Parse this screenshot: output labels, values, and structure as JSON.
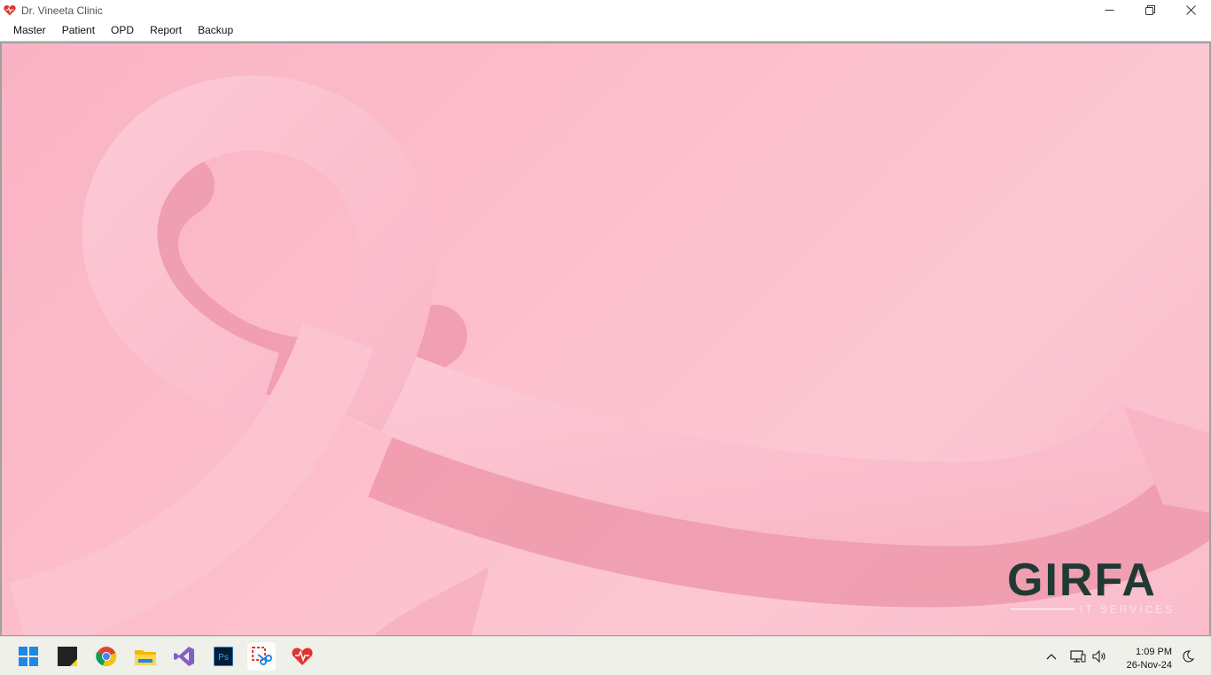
{
  "window": {
    "title": "Dr. Vineeta Clinic",
    "controls": {
      "minimize": "—",
      "restore": "❐",
      "close": "✕"
    }
  },
  "menu": {
    "items": [
      "Master",
      "Patient",
      "OPD",
      "Report",
      "Backup"
    ]
  },
  "background": {
    "logo_text": "GIRFA",
    "logo_sub": "IT SERVICES",
    "colors": {
      "ribbon": "#fcc0cf",
      "ribbon_shadow": "#ee94a8",
      "logo": "#1f3a33"
    }
  },
  "taskbar": {
    "apps": [
      "windows-start-icon",
      "sticky-notes-icon",
      "chrome-icon",
      "file-explorer-icon",
      "visual-studio-icon",
      "photoshop-icon",
      "snipping-tool-icon",
      "clinic-app-icon"
    ],
    "photoshop_label": "Ps",
    "clock_time": "1:09 PM",
    "clock_date": "26-Nov-24"
  }
}
